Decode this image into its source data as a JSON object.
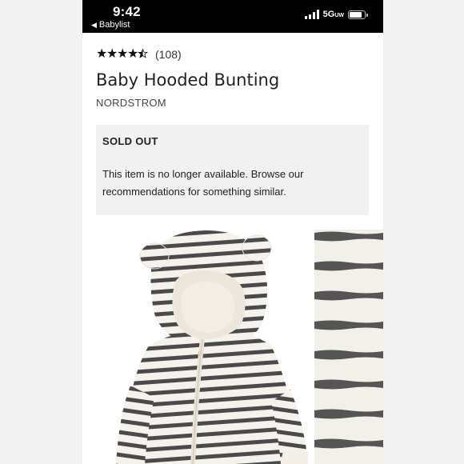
{
  "status_bar": {
    "time": "9:42",
    "back_label": "Babylist",
    "network": "5G",
    "network_sub": "UW"
  },
  "product": {
    "rating_stars": 4.5,
    "review_count": "(108)",
    "title": "Baby Hooded Bunting",
    "brand": "NORDSTROM"
  },
  "availability": {
    "heading": "SOLD OUT",
    "message": "This item is no longer available. Browse our recommendations for something similar."
  },
  "colors": {
    "stripe": "#4a4a4a",
    "fabric": "#f5f2ec",
    "panel": "#f1f1f1"
  }
}
